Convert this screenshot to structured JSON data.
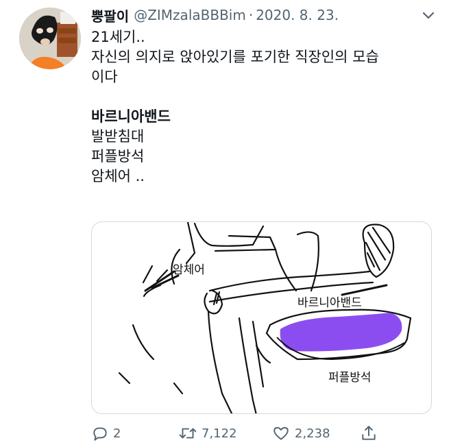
{
  "tweet": {
    "display_name": "뿡팔이",
    "handle": "@ZIMzalaBBBim",
    "separator": "·",
    "date": "2020. 8. 23.",
    "lines": [
      "21세기..",
      "자신의 의지로 앉아있기를 포기한 직장인의 모습",
      "이다",
      "",
      "바르니아밴드",
      "발받침대",
      "퍼플방석",
      "암체어 .."
    ]
  },
  "media": {
    "labels": {
      "armchair": "암체어",
      "band": "바르니아밴드",
      "cushion": "퍼플방석"
    },
    "colors": {
      "cushion": "#8c4df0"
    }
  },
  "actions": {
    "reply_count": "2",
    "retweet_count": "7,122",
    "like_count": "2,238"
  },
  "icons": [
    "avatar",
    "more-chevron-icon",
    "reply-icon",
    "retweet-icon",
    "like-icon",
    "share-icon"
  ]
}
